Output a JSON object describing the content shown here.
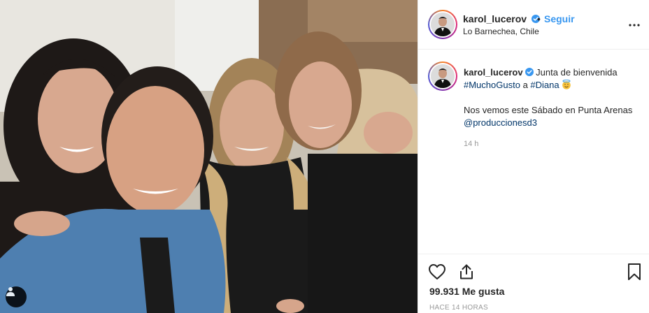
{
  "post": {
    "username": "karol_lucerov",
    "separator": "•",
    "follow_label": "Seguir",
    "location": "Lo Barnechea, Chile"
  },
  "caption": {
    "username": "karol_lucerov",
    "text_1": "Junta de bienvenida",
    "hashtag_1": "#MuchoGusto",
    "text_2": "a",
    "hashtag_2": "#Diana",
    "emoji": "smiling-face-with-halo",
    "text_3": "Nos vemos este Sábado en Punta Arenas",
    "mention": "@produccionesd3",
    "time": "14 h"
  },
  "footer": {
    "likes": "99.931 Me gusta",
    "date": "HACE 14 HORAS"
  },
  "icons": {
    "verified": "verified-badge-icon",
    "more": "more-options-icon",
    "like": "heart-icon",
    "share": "share-icon",
    "save": "bookmark-icon",
    "user_tags": "user-icon"
  },
  "colors": {
    "link_blue": "#3897f0",
    "hashtag": "#003569",
    "text": "#262626",
    "muted": "#999999"
  }
}
